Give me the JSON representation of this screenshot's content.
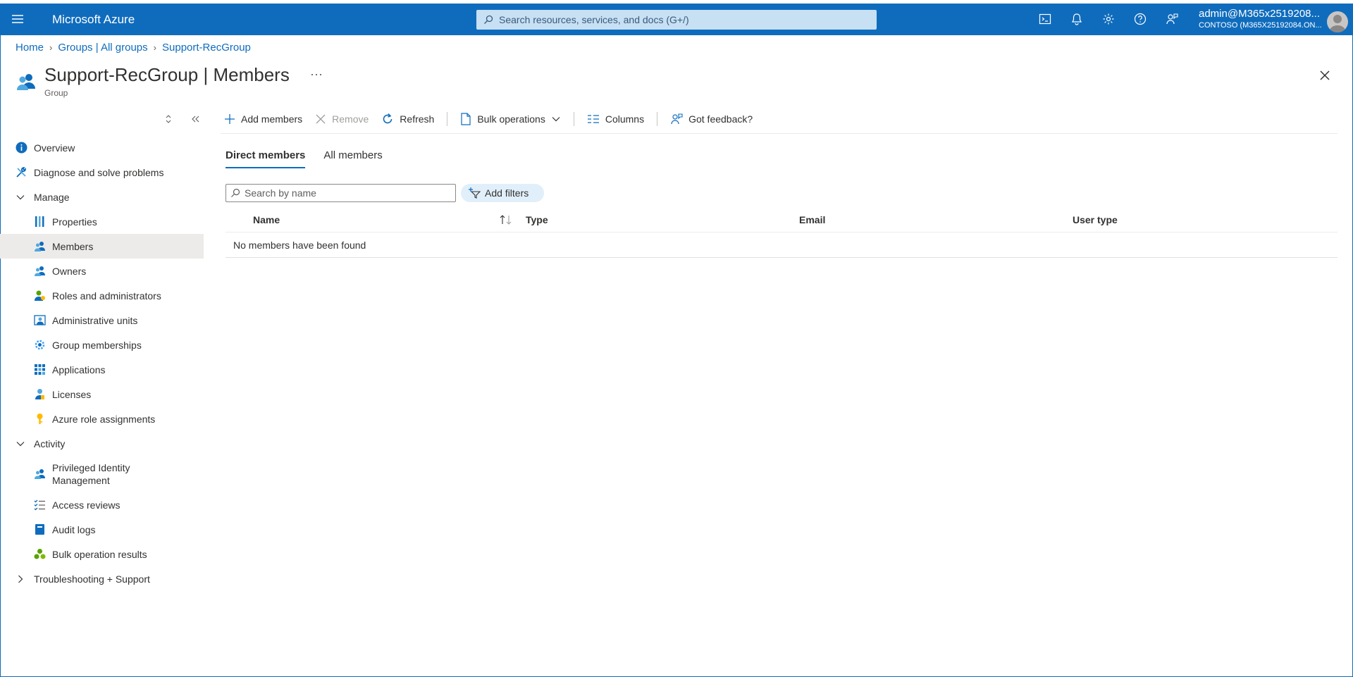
{
  "topbar": {
    "brand": "Microsoft Azure",
    "search_placeholder": "Search resources, services, and docs (G+/)",
    "account_user": "admin@M365x2519208...",
    "account_tenant": "CONTOSO (M365X25192084.ON..."
  },
  "breadcrumb": {
    "items": [
      "Home",
      "Groups | All groups",
      "Support-RecGroup"
    ]
  },
  "header": {
    "name": "Support-RecGroup",
    "separator": "|",
    "section": "Members",
    "subtitle": "Group",
    "more": "···"
  },
  "sidebar": {
    "items": [
      {
        "label": "Overview"
      },
      {
        "label": "Diagnose and solve problems"
      },
      {
        "label": "Manage"
      },
      {
        "label": "Properties"
      },
      {
        "label": "Members"
      },
      {
        "label": "Owners"
      },
      {
        "label": "Roles and administrators"
      },
      {
        "label": "Administrative units"
      },
      {
        "label": "Group memberships"
      },
      {
        "label": "Applications"
      },
      {
        "label": "Licenses"
      },
      {
        "label": "Azure role assignments"
      },
      {
        "label": "Activity"
      },
      {
        "label": "Privileged Identity Management"
      },
      {
        "label": "Access reviews"
      },
      {
        "label": "Audit logs"
      },
      {
        "label": "Bulk operation results"
      },
      {
        "label": "Troubleshooting + Support"
      }
    ]
  },
  "toolbar": {
    "add_members": "Add members",
    "remove": "Remove",
    "refresh": "Refresh",
    "bulk_operations": "Bulk operations",
    "columns": "Columns",
    "feedback": "Got feedback?"
  },
  "tabs": [
    "Direct members",
    "All members"
  ],
  "search": {
    "placeholder": "Search by name"
  },
  "filters": {
    "label": "Add filters"
  },
  "table": {
    "columns": [
      "Name",
      "Type",
      "Email",
      "User type"
    ],
    "empty_message": "No members have been found"
  },
  "colors": {
    "accent": "#0f6cbd",
    "search_bg": "#c7e0f4",
    "active_nav": "#edebe9",
    "filter_pill": "#e1effa"
  }
}
